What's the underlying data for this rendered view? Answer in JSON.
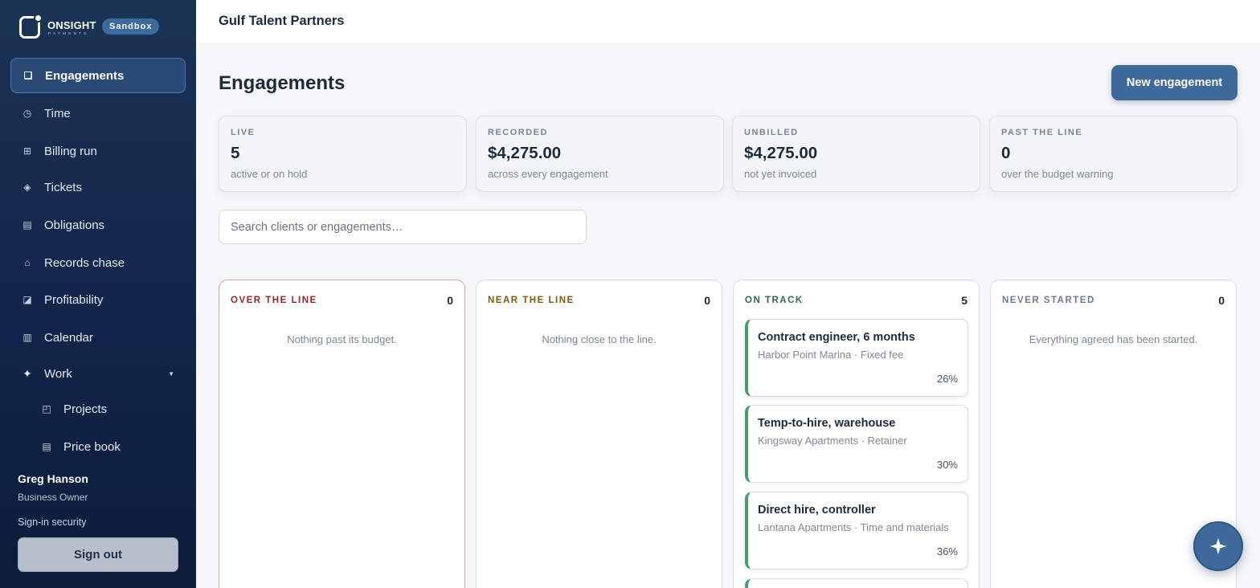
{
  "brand": {
    "name": "ONSIGHT",
    "sub": "PAYMENTS",
    "env_badge": "Sandbox"
  },
  "sidebar": {
    "items": [
      {
        "label": "Engagements",
        "icon": "square-icon"
      },
      {
        "label": "Time",
        "icon": "clock-icon"
      },
      {
        "label": "Billing run",
        "icon": "grid-icon"
      },
      {
        "label": "Tickets",
        "icon": "diamond-icon"
      },
      {
        "label": "Obligations",
        "icon": "list-icon"
      },
      {
        "label": "Records chase",
        "icon": "house-icon"
      },
      {
        "label": "Profitability",
        "icon": "chart-icon"
      },
      {
        "label": "Calendar",
        "icon": "calendar-icon"
      },
      {
        "label": "Work",
        "icon": "sparkle-icon"
      },
      {
        "label": "Projects",
        "icon": "folder-icon"
      },
      {
        "label": "Price book",
        "icon": "book-icon"
      }
    ],
    "active": "Engagements"
  },
  "user": {
    "name": "Greg Hanson",
    "role": "Business Owner",
    "security_link": "Sign-in security",
    "sign_out": "Sign out"
  },
  "header": {
    "org_name": "Gulf Talent Partners"
  },
  "page": {
    "title": "Engagements",
    "new_button": "New engagement"
  },
  "stats": [
    {
      "label": "LIVE",
      "value": "5",
      "sub": "active or on hold"
    },
    {
      "label": "RECORDED",
      "value": "$4,275.00",
      "sub": "across every engagement"
    },
    {
      "label": "UNBILLED",
      "value": "$4,275.00",
      "sub": "not yet invoiced"
    },
    {
      "label": "PAST THE LINE",
      "value": "0",
      "sub": "over the budget warning"
    }
  ],
  "search": {
    "placeholder": "Search clients or engagements…",
    "value": ""
  },
  "columns": [
    {
      "title": "OVER THE LINE",
      "count": "0",
      "empty": "Nothing past its budget.",
      "color": "#8a2b2e"
    },
    {
      "title": "NEAR THE LINE",
      "count": "0",
      "empty": "Nothing close to the line.",
      "color": "#7a5a10"
    },
    {
      "title": "ON TRACK",
      "count": "5",
      "empty": "",
      "color": "#2f6b4b",
      "cards": [
        {
          "title": "Contract engineer, 6 months",
          "sub": "Harbor Point Marina · Fixed fee",
          "pct": "26%"
        },
        {
          "title": "Temp-to-hire, warehouse",
          "sub": "Kingsway Apartments · Retainer",
          "pct": "30%"
        },
        {
          "title": "Direct hire, controller",
          "sub": "Lantana Apartments · Time and materials",
          "pct": "36%"
        }
      ]
    },
    {
      "title": "NEVER STARTED",
      "count": "0",
      "empty": "Everything agreed has been started.",
      "color": "#6f7a89"
    }
  ],
  "colors": {
    "accent": "#3e6a99",
    "on_track": "#4a9a72",
    "danger_border": "#d9a1a6"
  }
}
